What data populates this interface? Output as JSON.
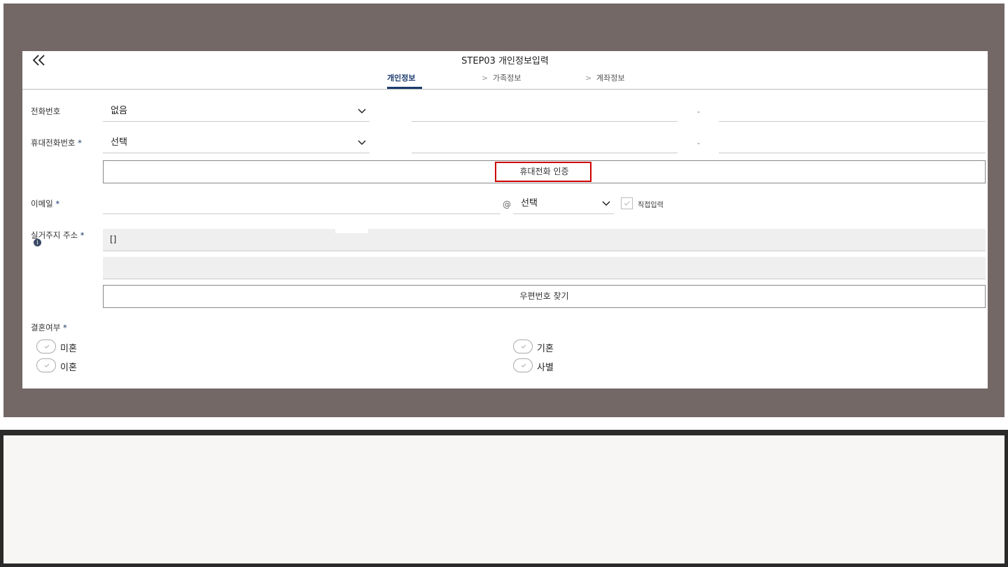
{
  "header": {
    "title": "STEP03 개인정보입력",
    "back_icon": "double-chevron-left-icon"
  },
  "tabs": [
    {
      "label": "개인정보",
      "active": true
    },
    {
      "label": "가족정보",
      "active": false
    },
    {
      "label": "계좌정보",
      "active": false
    }
  ],
  "phone": {
    "label": "전화번호",
    "select_value": "없음",
    "dash": "-"
  },
  "mobile": {
    "label": "휴대전화번호",
    "required_mark": "*",
    "select_value": "선택",
    "dash": "-",
    "verify_button": "휴대전화 인증"
  },
  "email": {
    "label": "이메일",
    "required_mark": "*",
    "at": "@",
    "domain_select": "선택",
    "direct_input_label": "직접입력"
  },
  "address": {
    "label": "실거주지 주소",
    "required_mark": "*",
    "line1_value": "[]",
    "line2_value": "",
    "zip_button": "우편번호 찾기",
    "info_icon": "i"
  },
  "marriage": {
    "label": "결혼여부",
    "required_mark": "*",
    "options": [
      "미혼",
      "기혼",
      "이혼",
      "사별"
    ]
  },
  "colors": {
    "backdrop": "#736866",
    "accent": "#1b3a6b",
    "highlight": "#cc0000"
  }
}
